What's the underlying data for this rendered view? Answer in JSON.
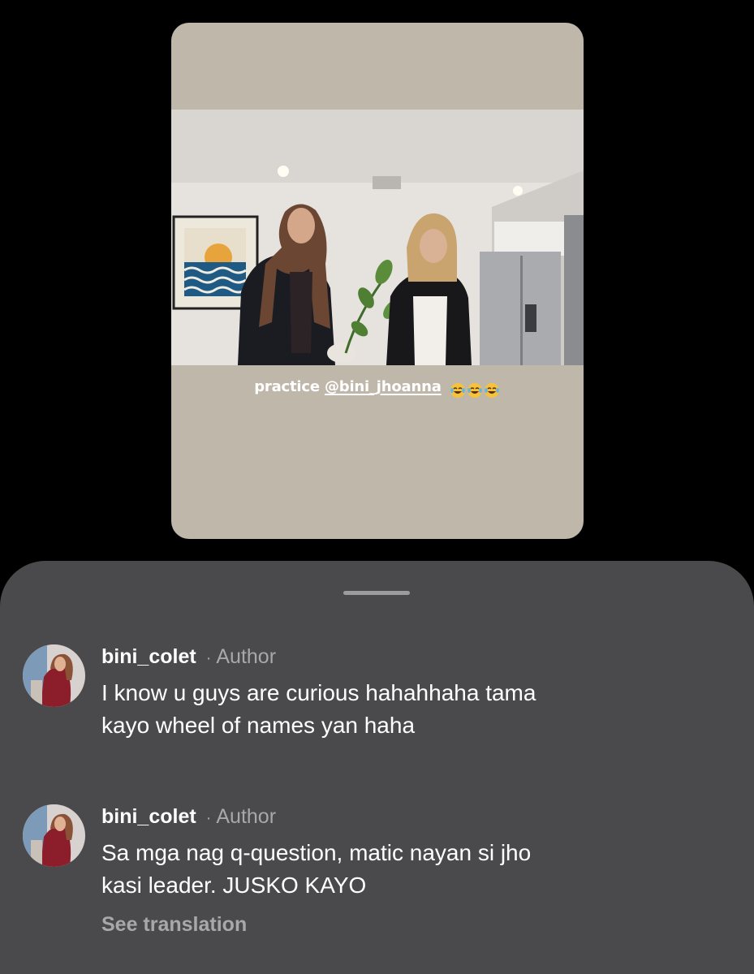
{
  "story": {
    "caption_prefix": "practice",
    "mention": "@bini_jhoanna",
    "emoji_icons": [
      "laughing-crying-emoji-icon",
      "laughing-crying-emoji-icon",
      "laughing-crying-emoji-icon"
    ],
    "background_color": "#c0b7ab"
  },
  "comments": [
    {
      "username": "bini_colet",
      "separator": "·",
      "tag": "Author",
      "text_line1": "I know u guys are curious hahahhaha tama",
      "text_line2": "kayo wheel of names yan haha"
    },
    {
      "username": "bini_colet",
      "separator": "·",
      "tag": "Author",
      "text_line1": "Sa mga nag q-question, matic nayan si jho",
      "text_line2": "kasi leader. JUSKO KAYO",
      "translation_label": "See translation"
    }
  ],
  "colors": {
    "sheet_background": "#4a4a4c",
    "secondary_text": "#a8a8ac",
    "primary_text": "#ffffff"
  }
}
